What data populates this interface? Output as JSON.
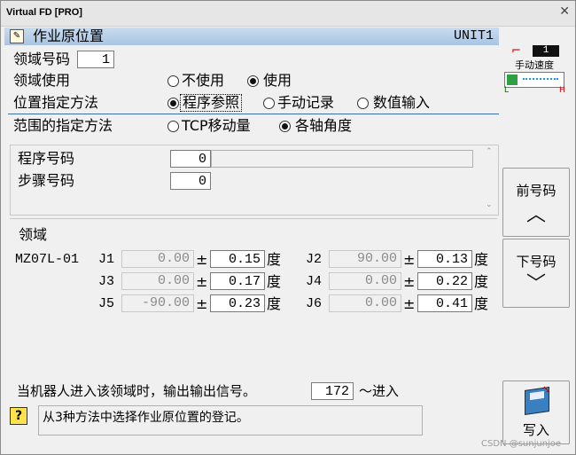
{
  "window": {
    "title": "Virtual FD [PRO]",
    "close_glyph": "✕"
  },
  "header": {
    "title": "作业原位置",
    "unit": "UNIT1",
    "icon": "form-icon"
  },
  "speed": {
    "label": "手动速度",
    "value": "1",
    "low": "L",
    "high": "H"
  },
  "region_no": {
    "label": "领域号码",
    "value": "1"
  },
  "region_use": {
    "label": "领域使用",
    "options": [
      "不使用",
      "使用"
    ],
    "selected": 1
  },
  "pos_method": {
    "label": "位置指定方法",
    "options": [
      "程序参照",
      "手动记录",
      "数值输入"
    ],
    "selected": 0
  },
  "range_method": {
    "label": "范围的指定方法",
    "options": [
      "TCP移动量",
      "各轴角度"
    ],
    "selected": 1
  },
  "program": {
    "prog_label": "程序号码",
    "prog_value": "0",
    "prog_name": "",
    "step_label": "步骤号码",
    "step_value": "0"
  },
  "region": {
    "title": "领域",
    "model": "MZ07L-01",
    "plusminus": "±",
    "unit": "度",
    "joints": [
      {
        "name": "J1",
        "value": "0.00",
        "tol": "0.15"
      },
      {
        "name": "J2",
        "value": "90.00",
        "tol": "0.13"
      },
      {
        "name": "J3",
        "value": "0.00",
        "tol": "0.17"
      },
      {
        "name": "J4",
        "value": "0.00",
        "tol": "0.22"
      },
      {
        "name": "J5",
        "value": "-90.00",
        "tol": "0.23"
      },
      {
        "name": "J6",
        "value": "0.00",
        "tol": "0.41"
      }
    ],
    "signal_text": "当机器人进入该领域时，输出输出信号。",
    "signal_value": "172",
    "signal_suffix": "～进入"
  },
  "hint": {
    "icon": "help-icon",
    "glyph": "?",
    "text": "从3种方法中选择作业原位置的登记。"
  },
  "buttons": {
    "prev": "前号码",
    "next": "下号码",
    "write": "写入"
  },
  "watermark": "CSDN @sunjunjoe",
  "colors": {
    "header_bg": "#b9d0ea",
    "separator": "#3a6ea5",
    "speed_bar": "#1e90ff",
    "limit_red": "#cc0000"
  }
}
